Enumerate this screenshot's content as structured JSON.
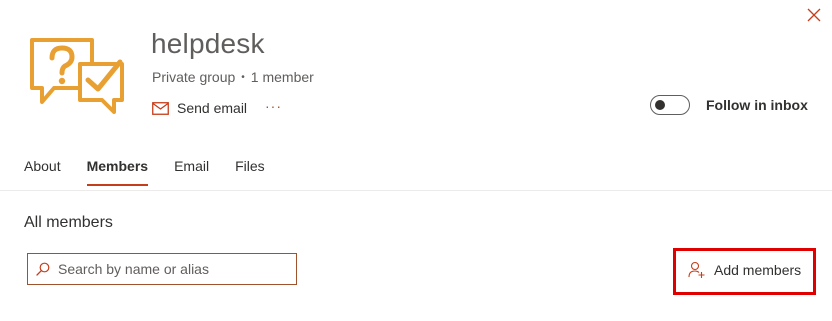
{
  "header": {
    "group_name": "helpdesk",
    "privacy": "Private group",
    "separator": "•",
    "member_count": "1 member",
    "send_email_label": "Send email",
    "more_label": "···",
    "follow_label": "Follow in inbox",
    "follow_enabled": false,
    "close_icon": "close-icon"
  },
  "tabs": [
    {
      "label": "About",
      "active": false
    },
    {
      "label": "Members",
      "active": true
    },
    {
      "label": "Email",
      "active": false
    },
    {
      "label": "Files",
      "active": false
    }
  ],
  "members": {
    "section_title": "All members",
    "search_placeholder": "Search by name or alias",
    "search_value": "",
    "add_members_label": "Add members"
  },
  "colors": {
    "accent": "#c43e1c",
    "icon_orange": "#e8a033",
    "highlight": "#e00000"
  }
}
